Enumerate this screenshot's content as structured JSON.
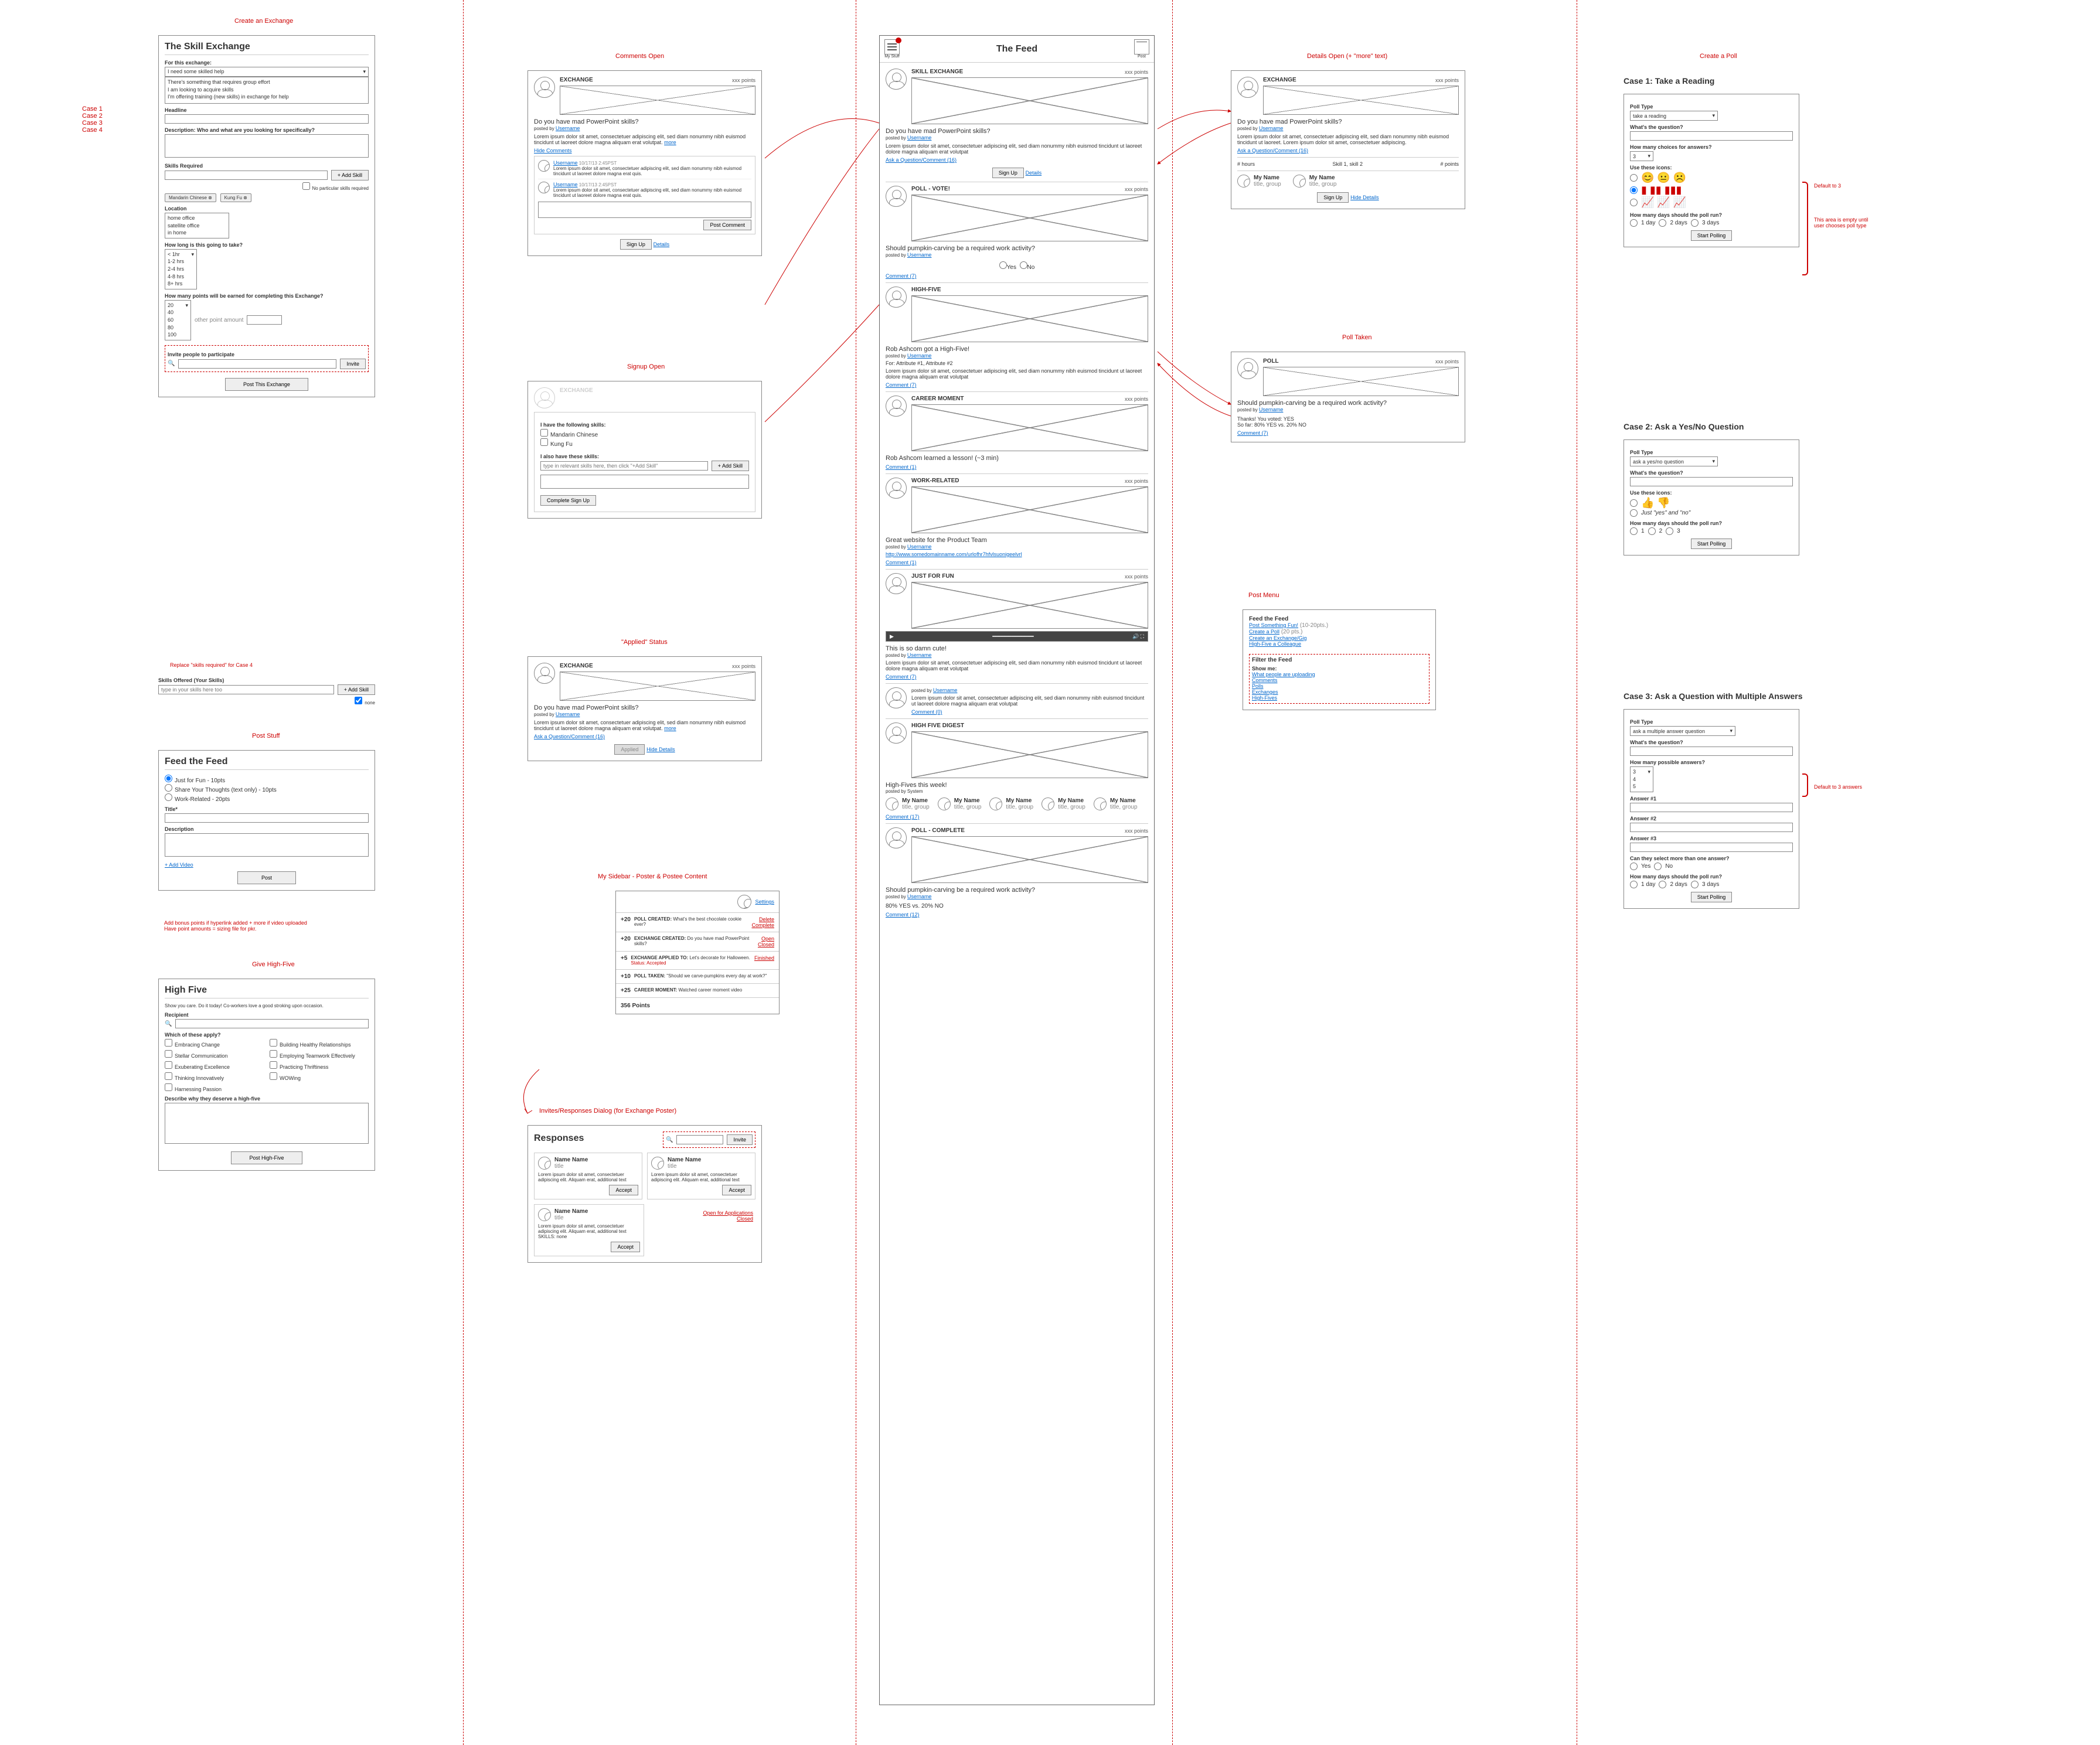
{
  "cols": {
    "cases": "Case 1\nCase 2\nCase 3\nCase 4"
  },
  "labels": {
    "createExchange": "Create an Exchange",
    "postStuff": "Post Stuff",
    "giveHighFive": "Give High-Five",
    "commentsOpen": "Comments Open",
    "signupOpen": "Signup Open",
    "appliedStatus": "\"Applied\" Status",
    "mySidebar": "My Sidebar - Poster & Postee Content",
    "invitesDialog": "Invites/Responses Dialog (for Exchange Poster)",
    "detailsOpen": "Details Open (+ \"more\" text)",
    "pollTaken": "Poll Taken",
    "postMenu": "Post Menu",
    "createPoll": "Create a Poll",
    "case1": "Case 1:  Take a Reading",
    "case2": "Case 2:  Ask a Yes/No Question",
    "case3": "Case 3:  Ask a Question with Multiple Answers",
    "replaceSkills": "Replace \"skills required\" for Case 4",
    "hintBonus": "Add bonus points if hyperlink added + more if video uploaded\nHave point amounts = sizing file for pkr.",
    "emptyArea": "This area is empty until user chooses poll type",
    "default3": "Default to 3",
    "default3ans": "Default to 3 answers"
  },
  "skillEx": {
    "title": "The Skill Exchange",
    "forThis": "For this exchange:",
    "select": "I need some skilled help",
    "opts": [
      "I need some skilled help",
      "There's something that requires group effort",
      "I am looking to acquire skills",
      "I'm offering training (new skills) in exchange for help"
    ],
    "headline": "Headline",
    "desc": "Description: Who and what are you looking for specifically?",
    "skillsReq": "Skills Required",
    "addSkill": "+ Add Skill",
    "noParticular": "No particular skills required",
    "chip1": "Mandarin Chinese",
    "chip2": "Kung Fu",
    "location": "Location",
    "locOpts": [
      "home office",
      "satellite office",
      "in home"
    ],
    "howLong": "How long is this going to take?",
    "timeOpts": [
      "< 1hr",
      "1-2 hrs",
      "2-4 hrs",
      "4-8 hrs",
      "8+ hrs"
    ],
    "points": "How many points will be earned for completing this Exchange?",
    "pointOpts": [
      "20",
      "40",
      "60",
      "80",
      "100"
    ],
    "otherAmt": "other point amount",
    "invite": "Invite people to participate",
    "inviteBtn": "Invite",
    "postBtn": "Post This Exchange",
    "skillsOffered": "Skills Offered (Your Skills)",
    "offeredPh": "type in your skills here too",
    "none": "none"
  },
  "feedForm": {
    "title": "Feed the Feed",
    "r1": "Just for Fun - 10pts",
    "r2": "Share Your Thoughts (text only) - 10pts",
    "r3": "Work-Related - 20pts",
    "titleLbl": "Title*",
    "descLbl": "Description",
    "addVideo": "+ Add Video",
    "postBtn": "Post"
  },
  "highFive": {
    "title": "High Five",
    "sub": "Show you care. Do it today! Co-workers love a good stroking upon occasion.",
    "recipient": "Recipient",
    "which": "Which of these apply?",
    "c1": "Embracing Change",
    "c2": "Stellar Communication",
    "c3": "Exuberating Excellence",
    "c4": "Thinking Innovatively",
    "c5": "Harnessing Passion",
    "c6": "Building Healthy Relationships",
    "c7": "Employing Teamwork Effectively",
    "c8": "Practicing Thriftiness",
    "c9": "WOWing",
    "why": "Describe why they deserve a high-five",
    "postBtn": "Post High-Five"
  },
  "commentsPanel": {
    "tag": "EXCHANGE",
    "pts": "xxx points",
    "q": "Do you have mad PowerPoint skills?",
    "posted": "posted by ",
    "user": "Username",
    "body": "Lorem ipsum dolor sit amet, consectetuer adipiscing elit, sed diam nonummy nibh euismod tincidunt ut laoreet dolore magna aliquam erat volutpat. ",
    "more": "more",
    "hide": "Hide Comments",
    "cUser": "Username",
    "cDate": "10/17/13 2:45PST",
    "cBody": "Lorem ipsum dolor sit amet, consectetuer adipiscing elit, sed diam nonummy nibh euismod tincidunt ut laoreet dolore magna erat quis.",
    "postComment": "Post Comment",
    "signUp": "Sign Up",
    "details": "Details"
  },
  "signupPanel": {
    "tag": "EXCHANGE",
    "haveSkills": "I have the following skills:",
    "s1": "Mandarin Chinese",
    "s2": "Kung Fu",
    "alsoHave": "I also have these skills:",
    "ph": "type in relevant skills here, then click \"+Add Skill\"",
    "addSkill": "+ Add Skill",
    "complete": "Complete Sign Up"
  },
  "appliedPanel": {
    "tag": "EXCHANGE",
    "pts": "xxx points",
    "q": "Do you have mad PowerPoint skills?",
    "posted": "posted by ",
    "user": "Username",
    "body": "Lorem ipsum dolor sit amet, consectetuer adipiscing elit, sed diam nonummy nibh euismod tincidunt ut laoreet dolore magna aliquam erat volutpat. ",
    "more": "more",
    "askQ": "Ask a Question/Comment (16)",
    "applied": "Applied",
    "hide": "Hide Details"
  },
  "sidebar": {
    "settings": "Settings",
    "pts1": "+20",
    "t1": "POLL CREATED:",
    "d1": "What's the best chocolate cookie ever?",
    "a1a": "Delete",
    "a1b": "Complete",
    "pts2": "+20",
    "t2": "EXCHANGE CREATED:",
    "d2": "Do you have mad PowerPoint skills?",
    "a2a": "Open",
    "a2b": "Closed",
    "pts3": "+5",
    "t3": "EXCHANGE APPLIED TO:",
    "d3": "Let's decorate for Halloween.",
    "status": "Status: Accepted",
    "a3": "Finished",
    "pts4": "+10",
    "t4": "POLL TAKEN:",
    "d4": "\"Should we carve-pumpkins every day at work?\"",
    "pts5": "+25",
    "t5": "CAREER MOMENT:",
    "d5": "Watched career moment video",
    "total": "356 Points"
  },
  "responses": {
    "title": "Responses",
    "invite": "Invite",
    "name": "Name Name",
    "sub": "title",
    "body": "Lorem ipsum dolor sit amet, consectetuer adipiscing elit. Aliquam erat, additional text",
    "skills": "SKILLS: none",
    "accept": "Accept",
    "open": "Open for Applications",
    "closed": "Closed"
  },
  "feed": {
    "title": "The Feed",
    "myStuff": "My Stuff",
    "post": "Post",
    "skillEx": "SKILL EXCHANGE",
    "exchange": "EXCHANGE",
    "pts": "xxx points",
    "q1": "Do you have mad PowerPoint skills?",
    "posted": "posted by ",
    "user": "Username",
    "body": "Lorem ipsum dolor sit amet, consectetuer adipiscing elit, sed diam nonummy nibh euismod tincidunt ut laoreet dolore magna aliquam erat volutpat",
    "askQ": "Ask a Question/Comment (16)",
    "signUp": "Sign Up",
    "details": "Details",
    "poll": "POLL - VOTE!",
    "pollQ": "Should pumpkin-carving be a required work activity?",
    "yes": "Yes",
    "no": "No",
    "commentN": "Comment (7)",
    "highFive": "HIGH-FIVE",
    "hfTitle": "Rob Ashcom got a High-Five!",
    "hfFor": "For: Attribute #1, Attribute #2",
    "career": "CAREER MOMENT",
    "cmTitle": "Rob Ashcom learned a lesson! (~3 min)",
    "comment1": "Comment (1)",
    "work": "WORK-RELATED",
    "wkTitle": "Great website for the Product Team",
    "wkUrl": "http://www.somedomainname.com/urlofhr7hfvlsuonigeelvrl",
    "justFun": "JUST FOR FUN",
    "jfTitle": "This is so damn cute!",
    "comment0": "Comment (0)",
    "hfDigest": "HIGH FIVE DIGEST",
    "hfWeek": "High-Fives this week!",
    "myName": "My Name",
    "myGroup": "title, group",
    "comment17": "Comment (17)",
    "pollComplete": "POLL - COMPLETE",
    "pcQ": "Should pumpkin-carving be a required work activity?",
    "pcRes": "80% YES vs. 20% NO",
    "comment12": "Comment (12)"
  },
  "detailsPanel": {
    "tag": "EXCHANGE",
    "pts": "xxx points",
    "q": "Do you have mad PowerPoint skills?",
    "posted": "posted by ",
    "user": "Username",
    "body": "Lorem ipsum dolor sit amet, consectetuer adipiscing elit, sed diam nonummy nibh euismod tincidunt ut laoreet. Lorem ipsum dolor sit amet, consectetuer adipiscing.",
    "askQ": "Ask a Question/Comment (16)",
    "hours": "# hours",
    "skills": "Skill 1, skill 2",
    "ptsLbl": "# points",
    "name": "My Name",
    "grp": "title, group",
    "signUp": "Sign Up",
    "hide": "Hide Details"
  },
  "pollTakenPanel": {
    "tag": "POLL",
    "pts": "xxx points",
    "q": "Should pumpkin-carving be a required work activity?",
    "posted": "posted by ",
    "user": "Username",
    "thanks": "Thanks! You voted: YES",
    "sofar": "So far: 80% YES vs. 20% NO",
    "comment": "Comment (7)"
  },
  "postMenu": {
    "feed": "Feed the Feed",
    "l1": "Post Something Fun!",
    "l1b": "(10-20pts.)",
    "l2": "Create a Poll",
    "l2b": "(20 pts.)",
    "l3": "Create an Exchange/Gig",
    "l4": "High-Five a Colleague",
    "filter": "Filter the Feed",
    "show": "Show me:",
    "f1": "What people are uploading",
    "f2": "Comments",
    "f3": "Polls",
    "f4": "Exchanges",
    "f5": "High-Fives"
  },
  "poll1": {
    "pollType": "Poll Type",
    "type": "take a reading",
    "whatQ": "What's the question?",
    "choices": "How many choices for answers?",
    "useIcons": "Use these icons:",
    "days": "How many days should the poll run?",
    "d1": "1 day",
    "d2": "2 days",
    "d3": "3 days",
    "start": "Start Polling"
  },
  "poll2": {
    "type": "ask a yes/no question",
    "useIcons": "Use these icons:",
    "justYN": "Just \"yes\" and \"no\"",
    "start": "Start Polling"
  },
  "poll3": {
    "type": "ask a multiple answer question",
    "howMany": "How many possible answers?",
    "opts": [
      "3",
      "4",
      "5"
    ],
    "a1": "Answer #1",
    "a2": "Answer #2",
    "a3": "Answer #3",
    "more": "Can they select more than one answer?",
    "start": "Start Polling"
  }
}
